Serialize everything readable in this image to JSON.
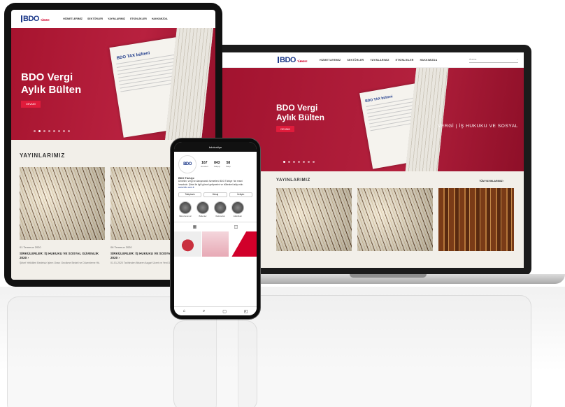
{
  "brand": {
    "name": "BDO",
    "sub": "TÜRKİYE"
  },
  "laptop": {
    "nav": {
      "menu": [
        "HİZMETLERİMİZ",
        "SEKTÖRLER",
        "YAYINLARIMIZ",
        "ETKİNLİKLER",
        "HAKKIMIZDA"
      ],
      "search": "Arama"
    },
    "hero": {
      "title": "BDO Vergi Aylık Bülten",
      "button": "DEVAMI",
      "tagline": "VERGİ | İŞ HUKUKU VE SOSYAL",
      "paper_heading": "BDO TAX bülteni"
    },
    "section": {
      "title": "YAYINLARIMIZ",
      "all_link": "TÜM YAYINLARIMIZ ›"
    }
  },
  "tablet": {
    "nav": {
      "menu": [
        "HİZMETLERİMİZ",
        "SEKTÖRLER",
        "YAYINLARIMIZ",
        "ETKİNLİKLER",
        "HAKKIMIZDA"
      ]
    },
    "hero": {
      "title": "BDO Vergi Aylık Bülten",
      "button": "DEVAMI",
      "paper_heading": "BDO TAX bülteni"
    },
    "section": {
      "title": "YAYINLARIMIZ"
    },
    "cards": [
      {
        "date": "01 Temmuz 2020",
        "title": "SİRKÜLERLER: İŞ HUKUKU VE SOSYAL GÜVENLİK 2020 ›",
        "desc": "Şirket Yetkilileri Bedelsiz İşlem Oranı Gecikme Bedeli ve Düzenleme Hk."
      },
      {
        "date": "06 Temmuz 2020",
        "title": "SİRKÜLERLER: İŞ HUKUKU VE SOSYAL GÜVENLİK 2020 ›",
        "desc": "01.01.2020 Tarihinden İtibaren Asgari Ücret ve Yeni Düzenlemeler"
      }
    ]
  },
  "phone": {
    "handle": "bdoturkiye",
    "stats": [
      {
        "n": "167",
        "l": "Gönderi"
      },
      {
        "n": "843",
        "l": "Takipçi"
      },
      {
        "n": "58",
        "l": "Takip"
      }
    ],
    "bio_name": "BDO Türkiye",
    "bio_text": "Denetim, vergi ve danışmanlık hizmetleri. BDO Türkiye 'nin resmi hesabıdır. Şirket ile ilgili güncel gelişmeleri ve bültenleri takip edin.",
    "bio_link": "www.bdo.com.tr",
    "buttons": [
      "Takiptesin",
      "Mesaj",
      "İletişim"
    ],
    "stories": [
      "Mikrofonumuz",
      "Bültenler",
      "Webinarlar",
      "Etkinlikler"
    ]
  },
  "colors": {
    "brand_blue": "#1d3a8a",
    "brand_red": "#d1002a",
    "hero_red": "#a7142f"
  }
}
